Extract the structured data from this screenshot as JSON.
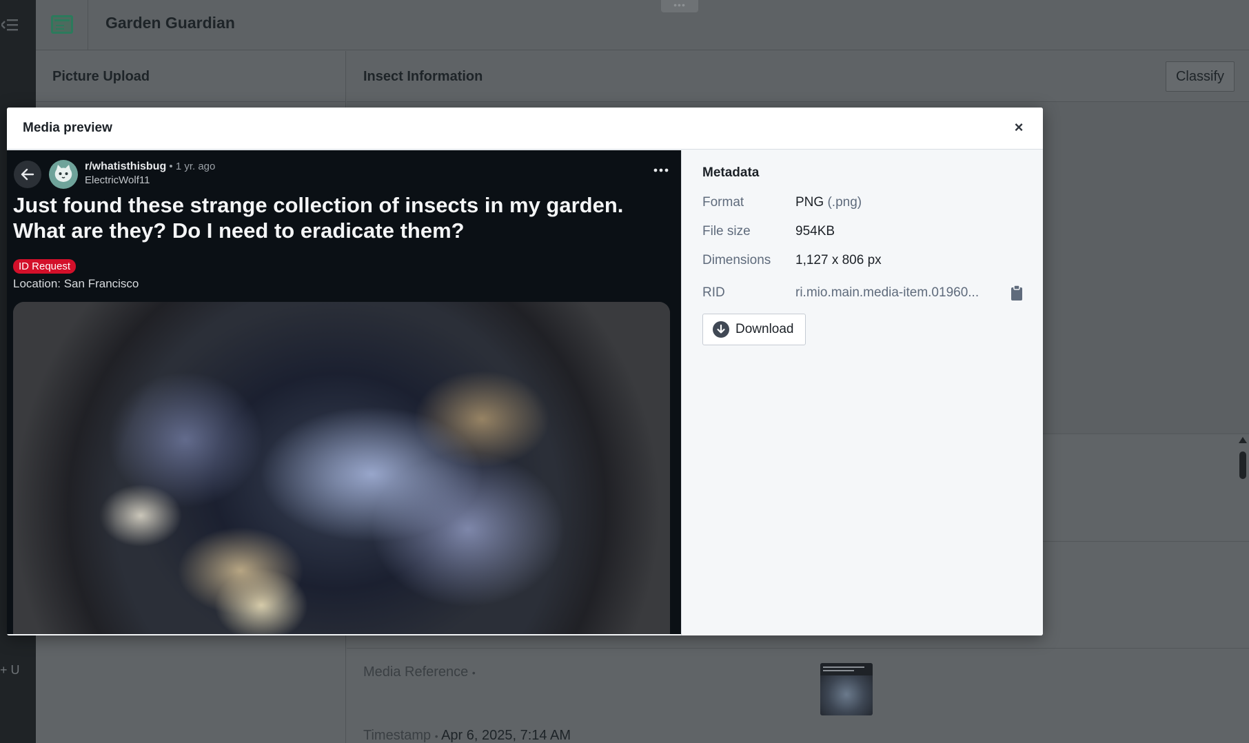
{
  "app": {
    "title": "Garden Guardian",
    "drag_handle": "•••"
  },
  "rail": {
    "bottom_label": "+ U"
  },
  "left_panel": {
    "title": "Picture Upload"
  },
  "right_panel": {
    "title": "Insect Information",
    "classify_label": "Classify",
    "media_reference_label": "Media Reference",
    "timestamp_label": "Timestamp",
    "timestamp_value": "Apr 6, 2025, 7:14 AM"
  },
  "modal": {
    "title": "Media preview",
    "close_glyph": "×",
    "preview": {
      "subreddit": "r/whatisthisbug",
      "time": " • 1 yr. ago",
      "author": "ElectricWolf11",
      "post_title": "Just found these strange collection of insects in my garden. What are they? Do I need to eradicate them?",
      "flair": "ID Request",
      "location": "Location: San Francisco"
    },
    "metadata": {
      "heading": "Metadata",
      "format_label": "Format",
      "format_value": "PNG",
      "format_ext": "(.png)",
      "size_label": "File size",
      "size_value": "954KB",
      "dimensions_label": "Dimensions",
      "dimensions_value": "1,127 x 806 px",
      "rid_label": "RID",
      "rid_value": "ri.mio.main.media-item.01960...",
      "download_label": "Download"
    }
  },
  "colors": {
    "flair_red": "#d3102a",
    "brand_green": "#2c7a5c",
    "overlay_dim": "#5f6366",
    "preview_bg": "#0b1015"
  }
}
